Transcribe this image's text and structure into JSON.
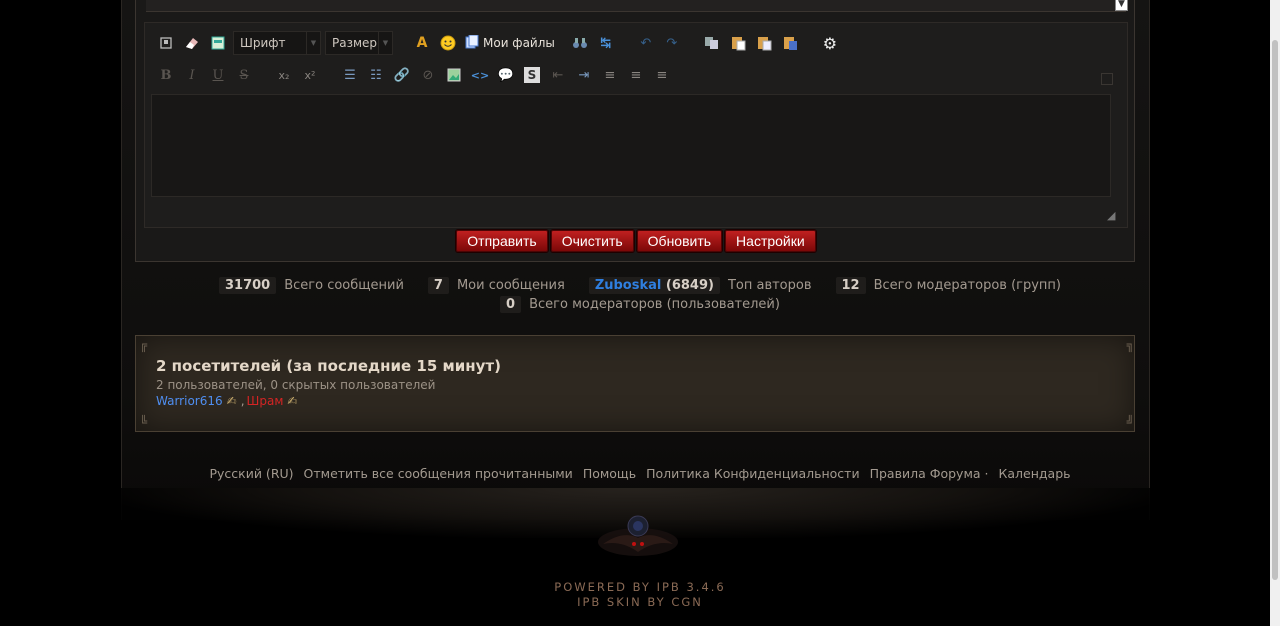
{
  "editor": {
    "font_combo": "Шрифт",
    "size_combo": "Размер",
    "my_files": "Мои файлы",
    "buttons": {
      "submit": "Отправить",
      "clear": "Очистить",
      "refresh": "Обновить",
      "settings": "Настройки"
    },
    "toolbar_row2": {
      "bold": "B",
      "italic": "I",
      "underline": "U",
      "strike": "S",
      "spoiler": "S"
    }
  },
  "stats": {
    "total_posts": {
      "num": "31700",
      "label": "Всего сообщений"
    },
    "my_posts": {
      "num": "7",
      "label": "Мои сообщения"
    },
    "top_author": {
      "user": "Zuboskal",
      "count": "(6849)",
      "label": "Топ авторов"
    },
    "mods_groups": {
      "num": "12",
      "label": "Всего модераторов (групп)"
    },
    "mods_users": {
      "num": "0",
      "label": "Всего модераторов (пользователей)"
    }
  },
  "visitors": {
    "title": "2 посетителей (за последние 15 минут)",
    "subtitle": "2 пользователей, 0 скрытых пользователей",
    "users": [
      "Warrior616",
      "Шрам"
    ],
    "separator": ","
  },
  "footer": {
    "links": [
      "Русский (RU)",
      "Отметить все сообщения прочитанными",
      "Помощь",
      "Политика Конфиденциальности",
      "Правила Форума",
      "Календарь"
    ],
    "dot": "·",
    "powered": "POWERED BY IPB 3.4.6",
    "skin": "IPB SKIN BY CGN"
  },
  "colors": {
    "button_red": "#a01212",
    "link_blue": "#2f7fe0",
    "user_red": "#d42424",
    "panel_bg": "#2e2820"
  }
}
